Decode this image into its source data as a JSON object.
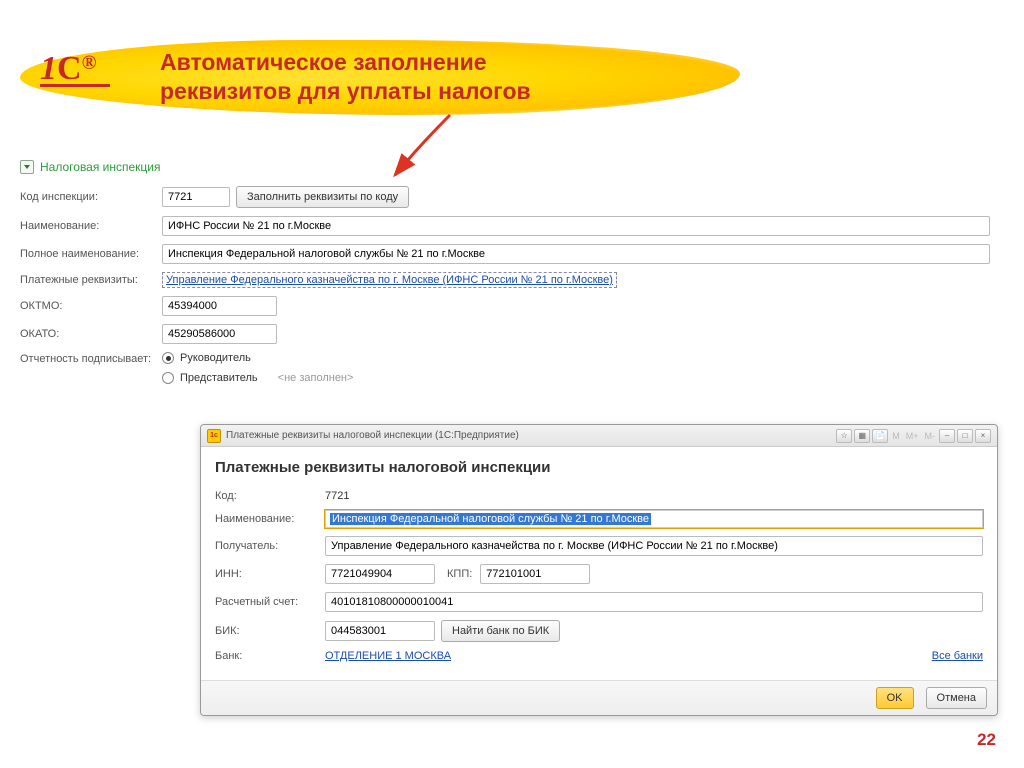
{
  "title_line1": "Автоматическое заполнение",
  "title_line2": "реквизитов для уплаты налогов",
  "section": {
    "title": "Налоговая инспекция",
    "code_label": "Код инспекции:",
    "code_value": "7721",
    "fill_button": "Заполнить реквизиты по коду",
    "name_label": "Наименование:",
    "name_value": "ИФНС России № 21 по г.Москве",
    "fullname_label": "Полное наименование:",
    "fullname_value": "Инспекция Федеральной налоговой службы № 21 по г.Москве",
    "payreq_label": "Платежные реквизиты:",
    "payreq_link": "Управление Федерального казначейства по г. Москве (ИФНС России № 21 по г.Москве)",
    "oktmo_label": "ОКТМО:",
    "oktmo_value": "45394000",
    "okato_label": "ОКАТО:",
    "okato_value": "45290586000",
    "signer_label": "Отчетность подписывает:",
    "radio_head": "Руководитель",
    "radio_rep": "Представитель",
    "rep_hint": "<не заполнен>"
  },
  "dialog": {
    "window_title": "Платежные реквизиты налоговой инспекции  (1С:Предприятие)",
    "heading": "Платежные реквизиты налоговой инспекции",
    "code_label": "Код:",
    "code_value": "7721",
    "name_label": "Наименование:",
    "name_value": "Инспекция Федеральной налоговой службы № 21 по г.Москве",
    "recipient_label": "Получатель:",
    "recipient_value": "Управление Федерального казначейства по г. Москве (ИФНС России № 21 по г.Москве)",
    "inn_label": "ИНН:",
    "inn_value": "7721049904",
    "kpp_label": "КПП:",
    "kpp_value": "772101001",
    "account_label": "Расчетный счет:",
    "account_value": "40101810800000010041",
    "bik_label": "БИК:",
    "bik_value": "044583001",
    "find_bank_btn": "Найти банк по БИК",
    "bank_label": "Банк:",
    "bank_link": "ОТДЕЛЕНИЕ 1 МОСКВА",
    "all_banks": "Все банки",
    "ok": "OK",
    "cancel": "Отмена"
  },
  "page_number": "22"
}
